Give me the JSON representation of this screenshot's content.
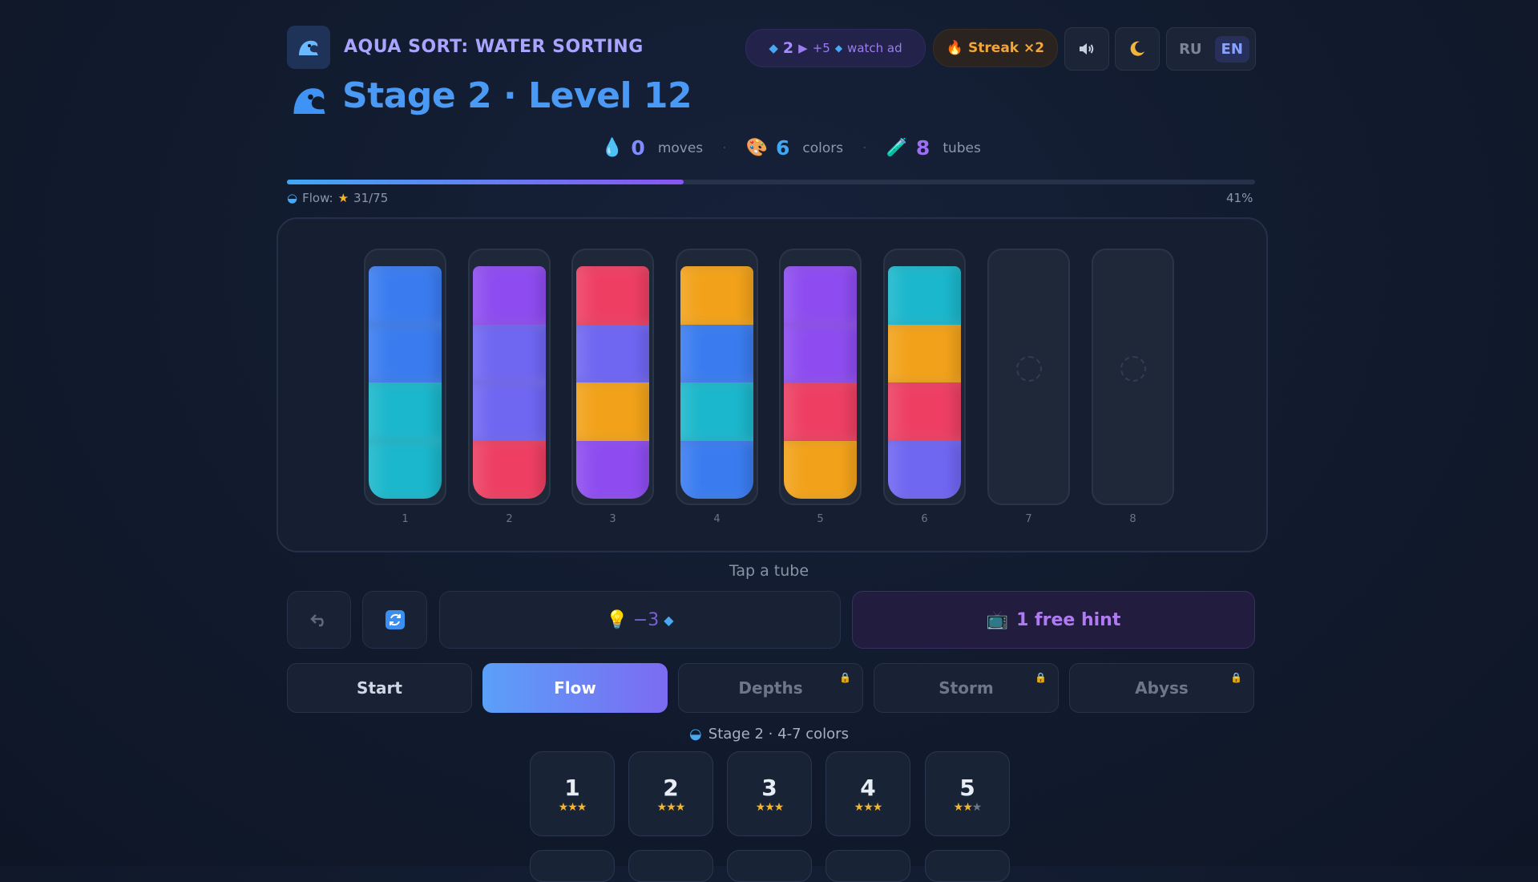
{
  "header": {
    "app_title": "AQUA SORT: WATER SORTING",
    "gems": "2",
    "gem_reward": "+5",
    "watch_ad": "watch ad",
    "streak": "Streak ×2",
    "languages": [
      "RU",
      "EN"
    ],
    "active_language": "EN"
  },
  "level_title": "Stage 2 · Level 12",
  "stats": {
    "moves_value": "0",
    "moves_label": "moves",
    "colors_value": "6",
    "colors_label": "colors",
    "tubes_value": "8",
    "tubes_label": "tubes"
  },
  "progress": {
    "label": "Flow:",
    "stars": "31/75",
    "percent_text": "41%",
    "fraction": 0.41
  },
  "palette": {
    "blue": "#3a7cf0",
    "teal": "#1bb7cc",
    "purple": "#8e4cf0",
    "indigo": "#6f66f2",
    "red": "#ee3f63",
    "orange": "#f2a21a",
    "lavender": "#b27af5"
  },
  "tubes": [
    {
      "number": "1",
      "layers": [
        "blue",
        "blue",
        "teal",
        "teal"
      ]
    },
    {
      "number": "2",
      "layers": [
        "purple",
        "indigo",
        "indigo",
        "red"
      ]
    },
    {
      "number": "3",
      "layers": [
        "red",
        "indigo",
        "orange",
        "purple"
      ]
    },
    {
      "number": "4",
      "layers": [
        "orange",
        "blue",
        "teal",
        "blue"
      ]
    },
    {
      "number": "5",
      "layers": [
        "purple",
        "purple",
        "red",
        "orange"
      ]
    },
    {
      "number": "6",
      "layers": [
        "teal",
        "orange",
        "red",
        "indigo"
      ]
    },
    {
      "number": "7",
      "layers": []
    },
    {
      "number": "8",
      "layers": []
    }
  ],
  "tap_hint": "Tap a tube",
  "controls": {
    "undo_icon": "undo-arrow-icon",
    "restart_icon": "restart-icon",
    "hint_cost": "−3",
    "free_hint": "1 free hint"
  },
  "modes": [
    {
      "label": "Start",
      "state": "normal"
    },
    {
      "label": "Flow",
      "state": "active"
    },
    {
      "label": "Depths",
      "state": "locked"
    },
    {
      "label": "Storm",
      "state": "locked"
    },
    {
      "label": "Abyss",
      "state": "locked"
    }
  ],
  "stage_subtitle": "Stage 2 · 4-7 colors",
  "levels": [
    {
      "number": "1",
      "stars": 3
    },
    {
      "number": "2",
      "stars": 3
    },
    {
      "number": "3",
      "stars": 3
    },
    {
      "number": "4",
      "stars": 3
    },
    {
      "number": "5",
      "stars": 2
    }
  ]
}
